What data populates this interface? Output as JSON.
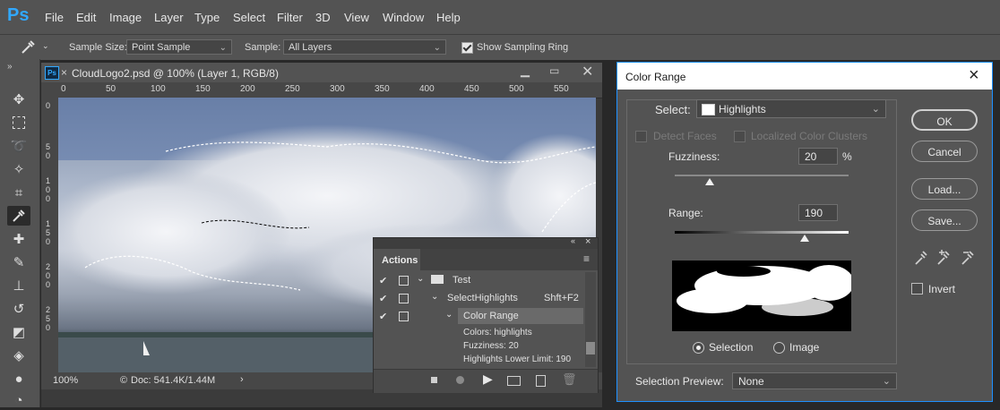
{
  "app": {
    "logo": "Ps"
  },
  "menu": [
    "File",
    "Edit",
    "Image",
    "Layer",
    "Type",
    "Select",
    "Filter",
    "3D",
    "View",
    "Window",
    "Help"
  ],
  "options_bar": {
    "sample_size_label": "Sample Size:",
    "sample_size_value": "Point Sample",
    "sample_label": "Sample:",
    "sample_value": "All Layers",
    "show_sampling_ring": "Show Sampling Ring"
  },
  "document": {
    "tab_title": "CloudLogo2.psd @ 100% (Layer 1, RGB/8)",
    "tab_icon": "Ps",
    "ruler_h": [
      "0",
      "50",
      "100",
      "150",
      "200",
      "250",
      "300",
      "350",
      "400",
      "450",
      "500",
      "550"
    ],
    "ruler_v": [
      "0",
      "5",
      "0",
      "1",
      "0",
      "0",
      "1",
      "5",
      "0",
      "2",
      "0",
      "0",
      "2",
      "5",
      "0"
    ],
    "zoom": "100%",
    "doc_info": "Doc: 541.4K/1.44M"
  },
  "actions_panel": {
    "title": "Actions",
    "set_name": "Test",
    "action_name": "SelectHighlights",
    "action_shortcut": "Shft+F2",
    "step_name": "Color Range",
    "details": [
      "Colors: highlights",
      "Fuzziness: 20",
      "Highlights Lower Limit: 190"
    ]
  },
  "color_range": {
    "title": "Color Range",
    "select_label": "Select:",
    "select_value": "Highlights",
    "detect_faces": "Detect Faces",
    "localized_clusters": "Localized Color Clusters",
    "fuzziness_label": "Fuzziness:",
    "fuzziness_value": "20",
    "fuzziness_unit": "%",
    "range_label": "Range:",
    "range_value": "190",
    "fuzziness_level": 0.2,
    "range_level": 0.745,
    "selection_radio": "Selection",
    "image_radio": "Image",
    "selection_preview_label": "Selection Preview:",
    "selection_preview_value": "None",
    "ok": "OK",
    "cancel": "Cancel",
    "load": "Load...",
    "save": "Save...",
    "invert": "Invert"
  }
}
